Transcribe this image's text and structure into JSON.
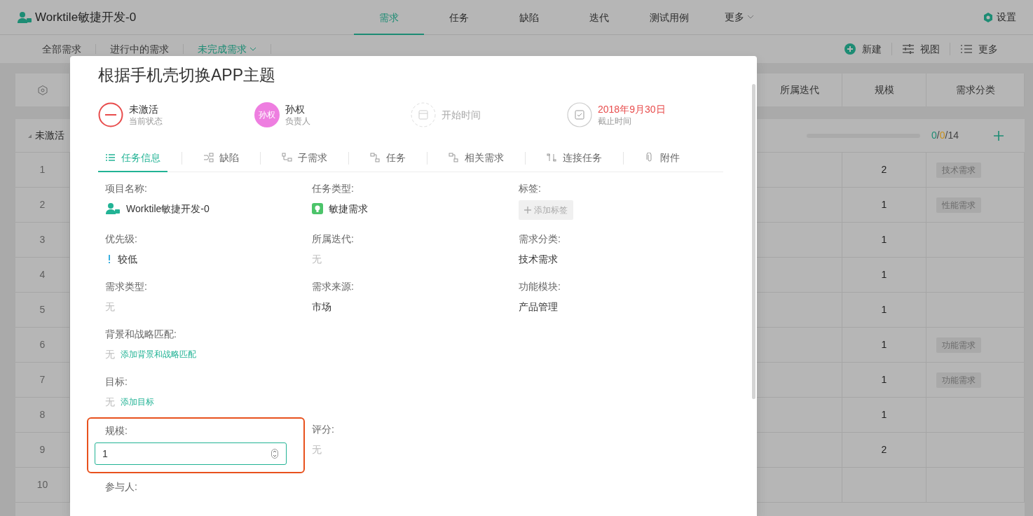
{
  "project": {
    "name": "Worktile敏捷开发-0"
  },
  "nav_tabs": [
    {
      "label": "需求",
      "selected": true
    },
    {
      "label": "任务",
      "selected": false
    },
    {
      "label": "缺陷",
      "selected": false
    },
    {
      "label": "迭代",
      "selected": false
    },
    {
      "label": "测试用例",
      "selected": false
    },
    {
      "label": "更多",
      "selected": false,
      "kind": "dropdown"
    }
  ],
  "settings": "设置",
  "sub_tabs": [
    {
      "label": "全部需求",
      "selected": false
    },
    {
      "label": "进行中的需求",
      "selected": false
    },
    {
      "label": "未完成需求",
      "selected": true
    }
  ],
  "toolbar": [
    "新建",
    "视图",
    "更多"
  ],
  "table": {
    "columns": [
      "所属迭代",
      "规模",
      "需求分类"
    ],
    "group": {
      "label": "未激活",
      "expanded": true,
      "level": 0,
      "done": "0",
      "in_progress": "0",
      "total": "14",
      "separator": "/"
    },
    "rows": [
      {
        "number": "1",
        "size": "2",
        "category": "技术需求"
      },
      {
        "number": "2",
        "size": "1",
        "category": "性能需求"
      },
      {
        "number": "3",
        "size": "1"
      },
      {
        "number": "4",
        "size": "1"
      },
      {
        "number": "5",
        "size": "1"
      },
      {
        "number": "6",
        "size": "1",
        "category": "功能需求"
      },
      {
        "number": "7",
        "size": "1",
        "category": "功能需求"
      },
      {
        "number": "8",
        "size": "1"
      },
      {
        "number": "9",
        "size": "2"
      },
      {
        "number": "10"
      }
    ]
  },
  "modal": {
    "title": "根据手机壳切换APP主题",
    "summary": [
      {
        "kind": "status",
        "value": "未激活",
        "caption": "当前状态"
      },
      {
        "kind": "assignee",
        "avatar": "孙权",
        "value": "孙权",
        "caption": "负责人"
      },
      {
        "kind": "start",
        "placeholder": "开始时间"
      },
      {
        "kind": "due",
        "value": "2018年9月30日",
        "caption": "截止时间",
        "overdue": true
      }
    ],
    "tabs": [
      {
        "label": "任务信息",
        "selected": true
      },
      {
        "label": "缺陷",
        "selected": false
      },
      {
        "label": "子需求",
        "selected": false
      },
      {
        "label": "任务",
        "selected": false
      },
      {
        "label": "相关需求",
        "selected": false
      },
      {
        "label": "连接任务",
        "selected": false
      },
      {
        "label": "附件",
        "selected": false
      }
    ],
    "fields": [
      {
        "label": "项目名称:",
        "kind": "project",
        "value": "Worktile敏捷开发-0"
      },
      {
        "label": "任务类型:",
        "kind": "type",
        "value": "敏捷需求"
      },
      {
        "label": "标签:",
        "kind": "tag",
        "action": "添加标签"
      },
      {
        "label": "优先级:",
        "kind": "priority",
        "value": "较低"
      },
      {
        "label": "所属迭代:",
        "kind": "text",
        "value": "无",
        "empty": true
      },
      {
        "label": "需求分类:",
        "kind": "text",
        "value": "技术需求"
      },
      {
        "label": "需求类型:",
        "kind": "text",
        "value": "无",
        "empty": true
      },
      {
        "label": "需求来源:",
        "kind": "text",
        "value": "市场"
      },
      {
        "label": "功能模块:",
        "kind": "text",
        "value": "产品管理"
      },
      {
        "label": "背景和战略匹配:",
        "kind": "text",
        "wide": true,
        "value": "无",
        "empty": true,
        "action": "添加背景和战略匹配"
      },
      {
        "label": "目标:",
        "kind": "text",
        "wide": true,
        "value": "无",
        "empty": true,
        "action": "添加目标"
      },
      {
        "label": "规模:",
        "kind": "input",
        "value": "1",
        "highlighted": true
      },
      {
        "label": "评分:",
        "kind": "text",
        "value": "无",
        "empty": true
      },
      {
        "label": "参与人:",
        "kind": "label",
        "wide": true
      }
    ]
  }
}
